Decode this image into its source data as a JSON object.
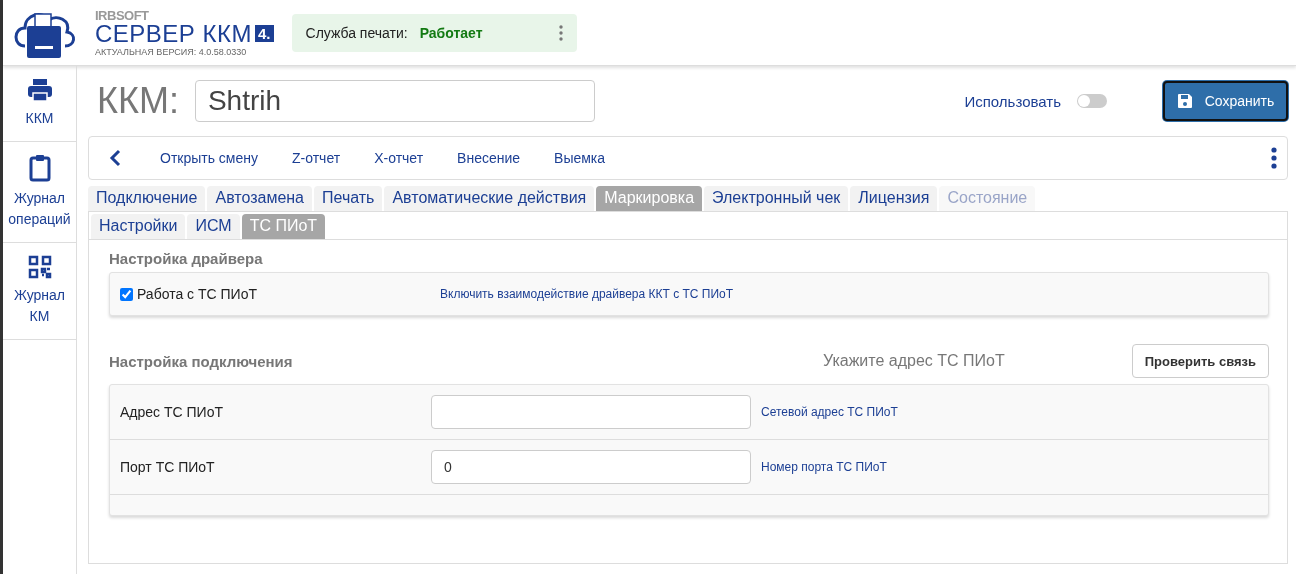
{
  "header": {
    "brand_small": "IRBSOFT",
    "brand": "СЕРВЕР ККМ",
    "brand_badge": "4.",
    "version": "АКТУАЛЬНАЯ ВЕРСИЯ: 4.0.58.0330",
    "service": {
      "label": "Служба печати:",
      "status": "Работает"
    }
  },
  "sidebar": {
    "items": [
      {
        "label": "ККМ"
      },
      {
        "label": "Журнал операций"
      },
      {
        "label": "Журнал КМ"
      }
    ]
  },
  "device": {
    "label": "ККМ:",
    "name": "Shtrih",
    "use_label": "Использовать",
    "use_on": false,
    "save_label": "Сохранить"
  },
  "toolbar": {
    "actions": [
      "Открыть смену",
      "Z-отчет",
      "X-отчет",
      "Внесение",
      "Выемка"
    ]
  },
  "tabs": [
    {
      "label": "Подключение",
      "selected": false,
      "disabled": false
    },
    {
      "label": "Автозамена",
      "selected": false,
      "disabled": false
    },
    {
      "label": "Печать",
      "selected": false,
      "disabled": false
    },
    {
      "label": "Автоматические действия",
      "selected": false,
      "disabled": false
    },
    {
      "label": "Маркировка",
      "selected": true,
      "disabled": false
    },
    {
      "label": "Электронный чек",
      "selected": false,
      "disabled": false
    },
    {
      "label": "Лицензия",
      "selected": false,
      "disabled": false
    },
    {
      "label": "Состояние",
      "selected": false,
      "disabled": true
    }
  ],
  "subtabs": [
    {
      "label": "Настройки",
      "selected": false
    },
    {
      "label": "ИСМ",
      "selected": false
    },
    {
      "label": "ТС ПИоТ",
      "selected": true
    }
  ],
  "driver_section": {
    "title": "Настройка драйвера",
    "option": {
      "label": "Работа с ТС ПИоТ",
      "checked": true,
      "hint": "Включить взаимодействие драйвера ККТ с ТС ПИоТ"
    }
  },
  "connection_section": {
    "title": "Настройка подключения",
    "notice": "Укажите адрес ТС ПИоТ",
    "check_button": "Проверить связь",
    "fields": [
      {
        "label": "Адрес ТС ПИоТ",
        "hint": "Сетевой адрес ТС ПИоТ"
      },
      {
        "label": "Порт ТС ПИоТ",
        "value": "0",
        "hint": "Номер порта ТС ПИоТ"
      }
    ]
  }
}
